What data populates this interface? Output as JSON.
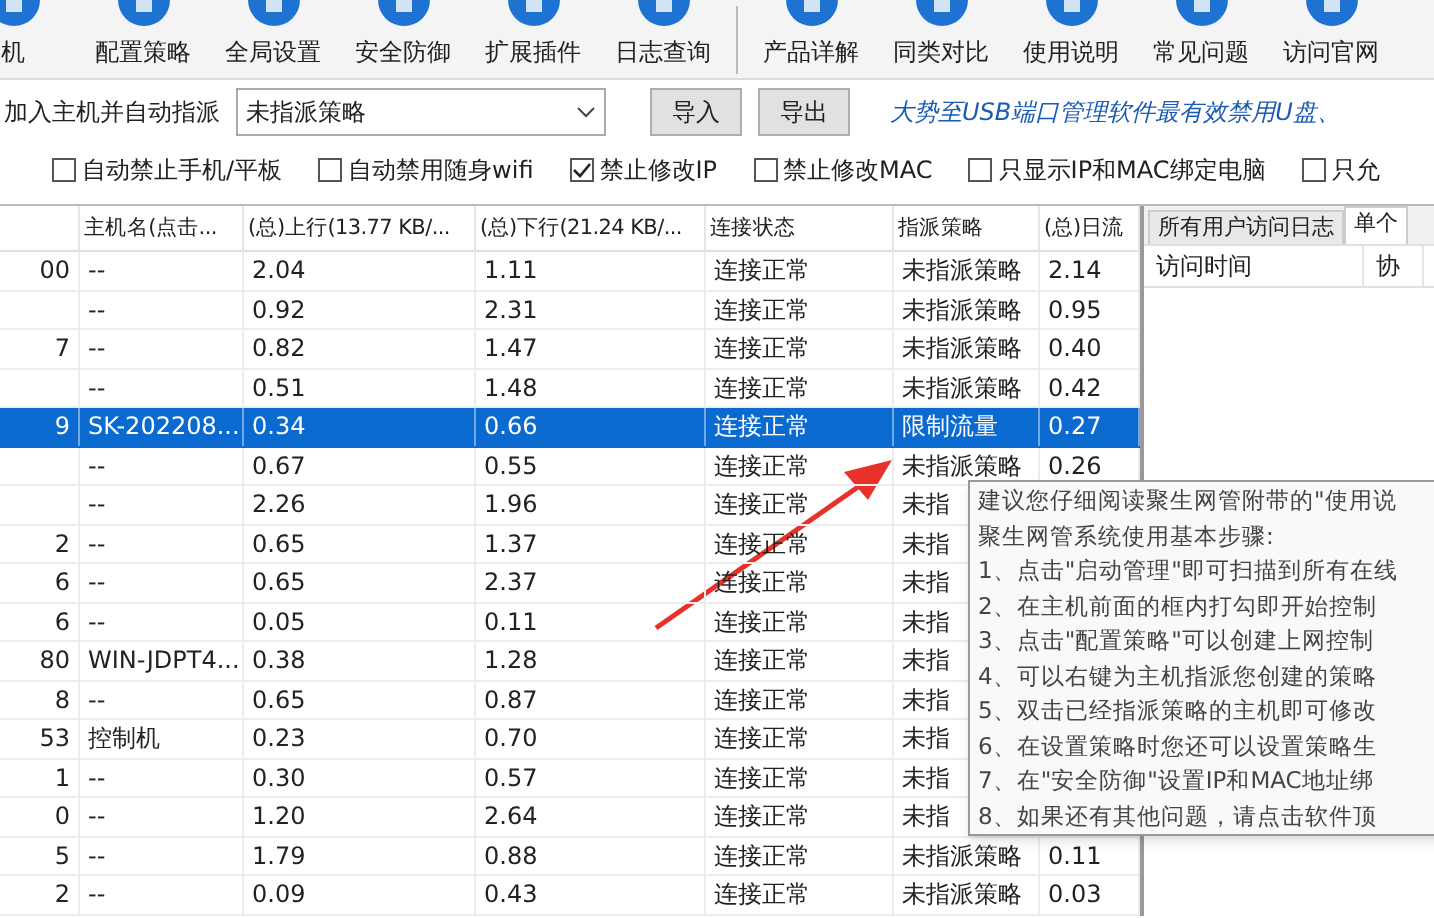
{
  "toolbar": [
    {
      "label": "机"
    },
    {
      "label": "配置策略"
    },
    {
      "label": "全局设置"
    },
    {
      "label": "安全防御"
    },
    {
      "label": "扩展插件"
    },
    {
      "label": "日志查询",
      "separator_after": true
    },
    {
      "label": "产品详解"
    },
    {
      "label": "同类对比"
    },
    {
      "label": "使用说明"
    },
    {
      "label": "常见问题"
    },
    {
      "label": "访问官网"
    }
  ],
  "assign": {
    "label": "加入主机并自动指派",
    "value": "未指派策略",
    "buttons": [
      "导入",
      "导出"
    ],
    "slogan": "大势至USB端口管理软件最有效禁用U盘、"
  },
  "options": [
    {
      "label": "自动禁止手机/平板",
      "checked": false
    },
    {
      "label": "自动禁用随身wifi",
      "checked": false
    },
    {
      "label": "禁止修改IP",
      "checked": true
    },
    {
      "label": "禁止修改MAC",
      "checked": false
    },
    {
      "label": "只显示IP和MAC绑定电脑",
      "checked": false
    },
    {
      "label": "只允",
      "checked": false
    }
  ],
  "table": {
    "columns": [
      "",
      "主机名(点击...",
      "(总)上行(13.77 KB/...",
      "(总)下行(21.24 KB/...",
      "连接状态",
      "指派策略",
      "(总)日流"
    ],
    "rows": [
      {
        "selected": false,
        "cells": [
          "00",
          "--",
          "2.04",
          "1.11",
          "连接正常",
          "未指派策略",
          "2.14"
        ]
      },
      {
        "selected": false,
        "cells": [
          "",
          "--",
          "0.92",
          "2.31",
          "连接正常",
          "未指派策略",
          "0.95"
        ]
      },
      {
        "selected": false,
        "cells": [
          "7",
          "--",
          "0.82",
          "1.47",
          "连接正常",
          "未指派策略",
          "0.40"
        ]
      },
      {
        "selected": false,
        "cells": [
          "",
          "--",
          "0.51",
          "1.48",
          "连接正常",
          "未指派策略",
          "0.42"
        ]
      },
      {
        "selected": true,
        "cells": [
          "9",
          "SK-202208...",
          "0.34",
          "0.66",
          "连接正常",
          "限制流量",
          "0.27"
        ]
      },
      {
        "selected": false,
        "cells": [
          "",
          "--",
          "0.67",
          "0.55",
          "连接正常",
          "未指派策略",
          "0.26"
        ]
      },
      {
        "selected": false,
        "cells": [
          "",
          "--",
          "2.26",
          "1.96",
          "连接正常",
          "未指",
          ""
        ]
      },
      {
        "selected": false,
        "cells": [
          "2",
          "--",
          "0.65",
          "1.37",
          "连接正常",
          "未指",
          ""
        ]
      },
      {
        "selected": false,
        "cells": [
          "6",
          "--",
          "0.65",
          "2.37",
          "连接正常",
          "未指",
          ""
        ]
      },
      {
        "selected": false,
        "cells": [
          "6",
          "--",
          "0.05",
          "0.11",
          "连接正常",
          "未指",
          ""
        ]
      },
      {
        "selected": false,
        "cells": [
          "80",
          "WIN-JDPT4...",
          "0.38",
          "1.28",
          "连接正常",
          "未指",
          ""
        ]
      },
      {
        "selected": false,
        "cells": [
          "8",
          "--",
          "0.65",
          "0.87",
          "连接正常",
          "未指",
          ""
        ]
      },
      {
        "selected": false,
        "cells": [
          "53",
          "控制机",
          "0.23",
          "0.70",
          "连接正常",
          "未指",
          ""
        ]
      },
      {
        "selected": false,
        "cells": [
          "1",
          "--",
          "0.30",
          "0.57",
          "连接正常",
          "未指",
          ""
        ]
      },
      {
        "selected": false,
        "cells": [
          "0",
          "--",
          "1.20",
          "2.64",
          "连接正常",
          "未指",
          ""
        ]
      },
      {
        "selected": false,
        "cells": [
          "5",
          "--",
          "1.79",
          "0.88",
          "连接正常",
          "未指派策略",
          "0.11"
        ]
      },
      {
        "selected": false,
        "cells": [
          "2",
          "--",
          "0.09",
          "0.43",
          "连接正常",
          "未指派策略",
          "0.03"
        ]
      }
    ]
  },
  "log_panel": {
    "tabs": [
      {
        "label": "所有用户访问日志",
        "selected": false
      },
      {
        "label": "单个",
        "selected": true
      }
    ],
    "columns": [
      "访问时间",
      "协"
    ]
  },
  "tooltip": {
    "lines": [
      "建议您仔细阅读聚生网管附带的\"使用说",
      "聚生网管系统使用基本步骤:",
      "1、点击\"启动管理\"即可扫描到所有在线",
      "2、在主机前面的框内打勾即开始控制",
      "3、点击\"配置策略\"可以创建上网控制",
      "4、可以右键为主机指派您创建的策略",
      "5、双击已经指派策略的主机即可修改",
      "6、在设置策略时您还可以设置策略生",
      "7、在\"安全防御\"设置IP和MAC地址绑",
      "8、如果还有其他问题，请点击软件顶"
    ]
  }
}
